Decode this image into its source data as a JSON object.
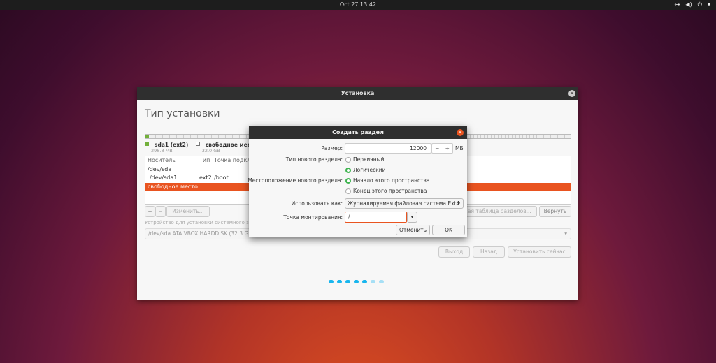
{
  "topbar": {
    "clock": "Oct 27  13:42",
    "icons": [
      "network-icon",
      "volume-icon",
      "power-icon",
      "chevron-down-icon"
    ]
  },
  "window": {
    "title": "Установка",
    "heading": "Тип установки",
    "legend": [
      {
        "name": "sda1 (ext2)",
        "size": "298.8 MB",
        "color": "#73b03b"
      },
      {
        "name": "свободное место",
        "size": "32.0 GB",
        "color": "#ffffff"
      }
    ],
    "table": {
      "headers": [
        "Носитель",
        "Тип",
        "Точка подкл"
      ],
      "rows": [
        [
          "/dev/sda",
          "",
          ""
        ],
        [
          " /dev/sda1",
          "ext2",
          "/boot"
        ],
        [
          "свободное место",
          "",
          ""
        ]
      ],
      "selected_row": 2
    },
    "add": "+",
    "remove": "−",
    "change": "Изменить...",
    "new_table": "Новая таблица разделов...",
    "revert": "Вернуть",
    "bootloader_label": "Устройство для установки системного загрузчика:",
    "bootloader_value": "/dev/sda   ATA VBOX HARDDISK (32.3 GB)",
    "quit": "Выход",
    "back": "Назад",
    "install": "Установить сейчас",
    "progress_steps": 7,
    "progress_done": 5
  },
  "dialog": {
    "title": "Создать раздел",
    "size_label": "Размер:",
    "size_value": "12000",
    "size_minus": "−",
    "size_plus": "+",
    "size_unit": "МБ",
    "type_label": "Тип нового раздела:",
    "type_primary": "Первичный",
    "type_logical": "Логический",
    "location_label": "Местоположение нового раздела:",
    "loc_begin": "Начало этого пространства",
    "loc_end": "Конец этого пространства",
    "use_as_label": "Использовать как:",
    "use_as_value": "Журналируемая файловая система Ext4",
    "mount_label": "Точка монтирования:",
    "mount_value": "/",
    "cancel": "Отменить",
    "ok": "OK"
  }
}
